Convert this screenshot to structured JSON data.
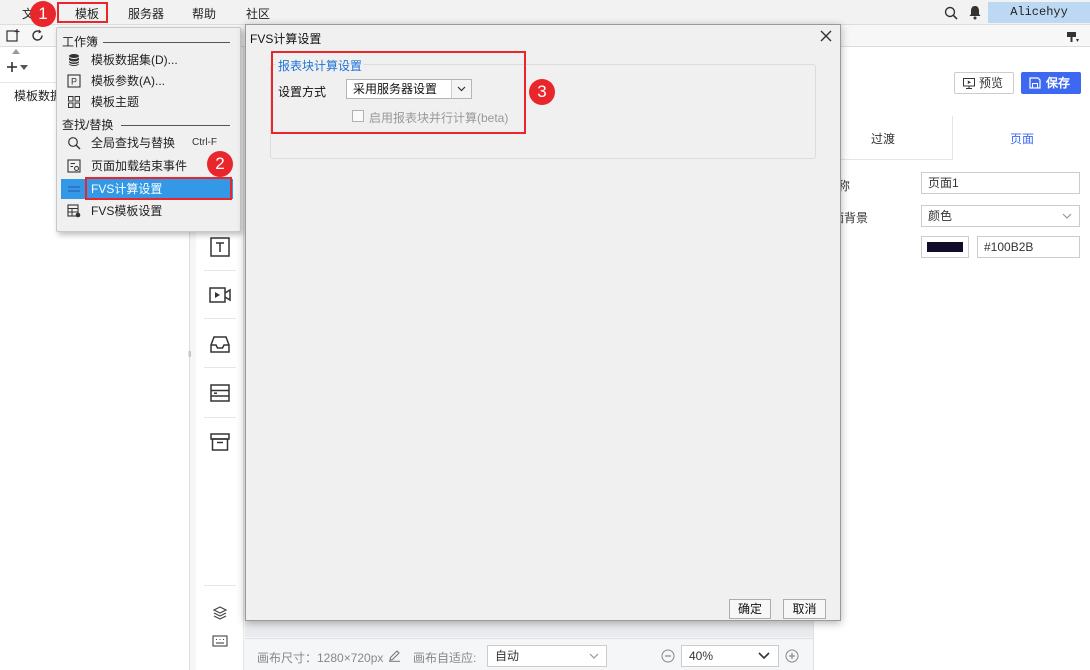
{
  "menubar": {
    "items": [
      "文",
      "模板",
      "服务器",
      "帮助",
      "社区"
    ],
    "user": "Alicehyy"
  },
  "left_panel": {
    "dataset_label": "模板数据"
  },
  "dropdown": {
    "group1": "工作簿",
    "group2": "查找/替换",
    "items": [
      {
        "label": "模板数据集(D)...",
        "shortcut": ""
      },
      {
        "label": "模板参数(A)...",
        "shortcut": ""
      },
      {
        "label": "模板主题",
        "shortcut": ""
      },
      {
        "label": "全局查找与替换",
        "shortcut": "Ctrl-F"
      },
      {
        "label": "页面加载结束事件",
        "shortcut": ""
      },
      {
        "label": "FVS计算设置",
        "shortcut": ""
      },
      {
        "label": "FVS模板设置",
        "shortcut": ""
      }
    ]
  },
  "dialog": {
    "title": "FVS计算设置",
    "group_title": "报表块计算设置",
    "setting_label": "设置方式",
    "setting_value": "采用服务器设置",
    "parallel_label": "启用报表块并行计算(beta)",
    "ok_label": "确定",
    "cancel_label": "取消"
  },
  "right_panel": {
    "preview_label": "预览",
    "save_label": "保存",
    "tabs": [
      "过渡",
      "页面"
    ],
    "name_label": "称",
    "name_value": "页面1",
    "bg_label": "面背景",
    "bg_type": "颜色",
    "bg_color_hex": "#100B2B"
  },
  "bottom_bar": {
    "canvas_size_label": "画布尺寸：1280×720px",
    "adapt_label": "画布自适应:",
    "adapt_value": "自动",
    "zoom_value": "40%"
  },
  "annotations": [
    "1",
    "2",
    "3"
  ],
  "colors": {
    "accent": "#3d68f2",
    "annotation_red": "#e8262b",
    "selected_item": "#3399e6",
    "legend_blue": "#1e73d6"
  }
}
